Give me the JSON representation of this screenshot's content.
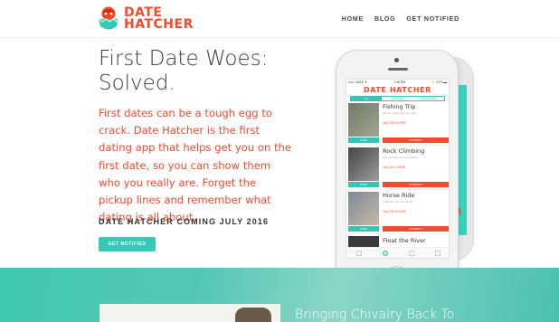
{
  "brand": {
    "line1": "DATE",
    "line2": "HATCHER",
    "accent": "#f24b2e",
    "teal": "#35c9b8"
  },
  "nav": {
    "items": [
      "HOME",
      "BLOG",
      "GET NOTIFIED"
    ]
  },
  "hero": {
    "title": "First Date Woes: Solved.",
    "body": "First dates can be a tough egg to crack. Date Hatcher is the first dating app that helps get you on the first date, so you can show them who you really are. Forget the pickup lines and remember what dating is all about.",
    "coming": "DATE HATCHER COMING JULY 2016",
    "cta": "GET NOTIFIED"
  },
  "phone": {
    "carrier": "••••○ DATE ✈",
    "time": "7:26 PM",
    "battery": "⚡ 57% ▬",
    "app_title": "DATE HATCHER",
    "back_letter": "R",
    "tabs": [
      "ALL",
      "PENDING",
      "CONNECTED"
    ],
    "cards": [
      {
        "title": "Fishing Trip",
        "sub": "No cell, all the fish you want",
        "date": "July 27th, 8:00PM",
        "a": "SAVE",
        "b": "CONNECT"
      },
      {
        "title": "Rock Climbing",
        "sub": "Fun and time we were talking",
        "date": "July 31st, 2:00PM",
        "a": "SAVE",
        "b": "CONNECT"
      },
      {
        "title": "Horse Ride",
        "sub": "Trails through the country",
        "date": "July 27th, 6:00PM",
        "a": "SAVE",
        "b": "CONNECT"
      }
    ],
    "last_card": "Float the River"
  },
  "band": {
    "title": "Bringing Chivalry Back To"
  }
}
